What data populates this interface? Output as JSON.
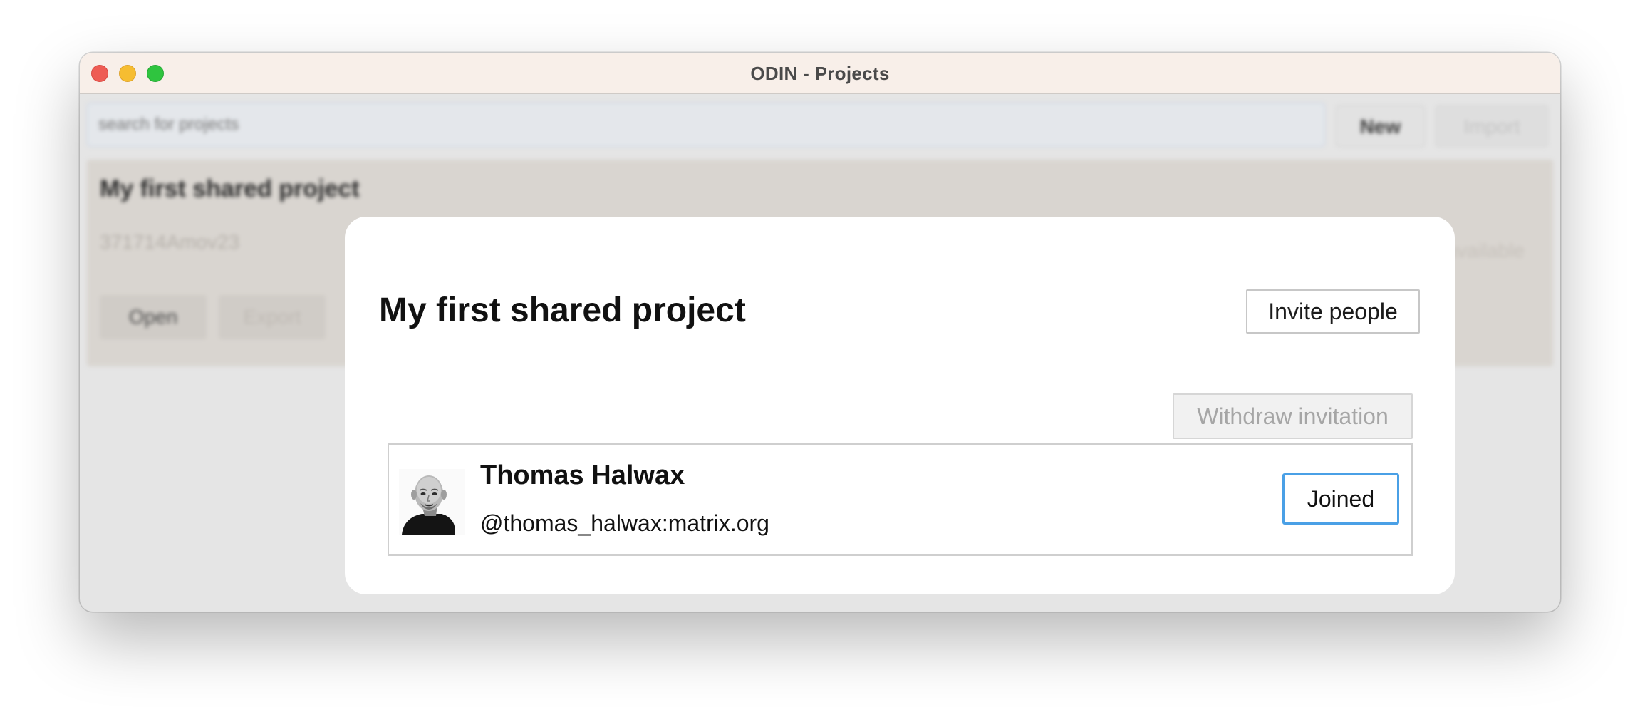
{
  "window": {
    "title": "ODIN - Projects"
  },
  "background": {
    "search_placeholder": "search for projects",
    "new_button_label": "New",
    "import_button_label": "Import",
    "project_card": {
      "title": "My first shared project",
      "id": "371714Amov23",
      "status": "not available",
      "open_button_label": "Open",
      "export_button_label": "Export"
    }
  },
  "dialog": {
    "title": "My first shared project",
    "invite_button_label": "Invite people",
    "withdraw_button_label": "Withdraw invitation",
    "members": [
      {
        "name": "Thomas Halwax",
        "handle": "@thomas_halwax:matrix.org",
        "status_button_label": "Joined",
        "avatar_icon": "person-avatar-icon"
      }
    ]
  },
  "colors": {
    "titlebar_bg": "#f8efe9",
    "focus_border": "#4aa0e6",
    "traffic_close": "#ee5c54",
    "traffic_minimize": "#f6bd31",
    "traffic_maximize": "#2fc43f"
  }
}
